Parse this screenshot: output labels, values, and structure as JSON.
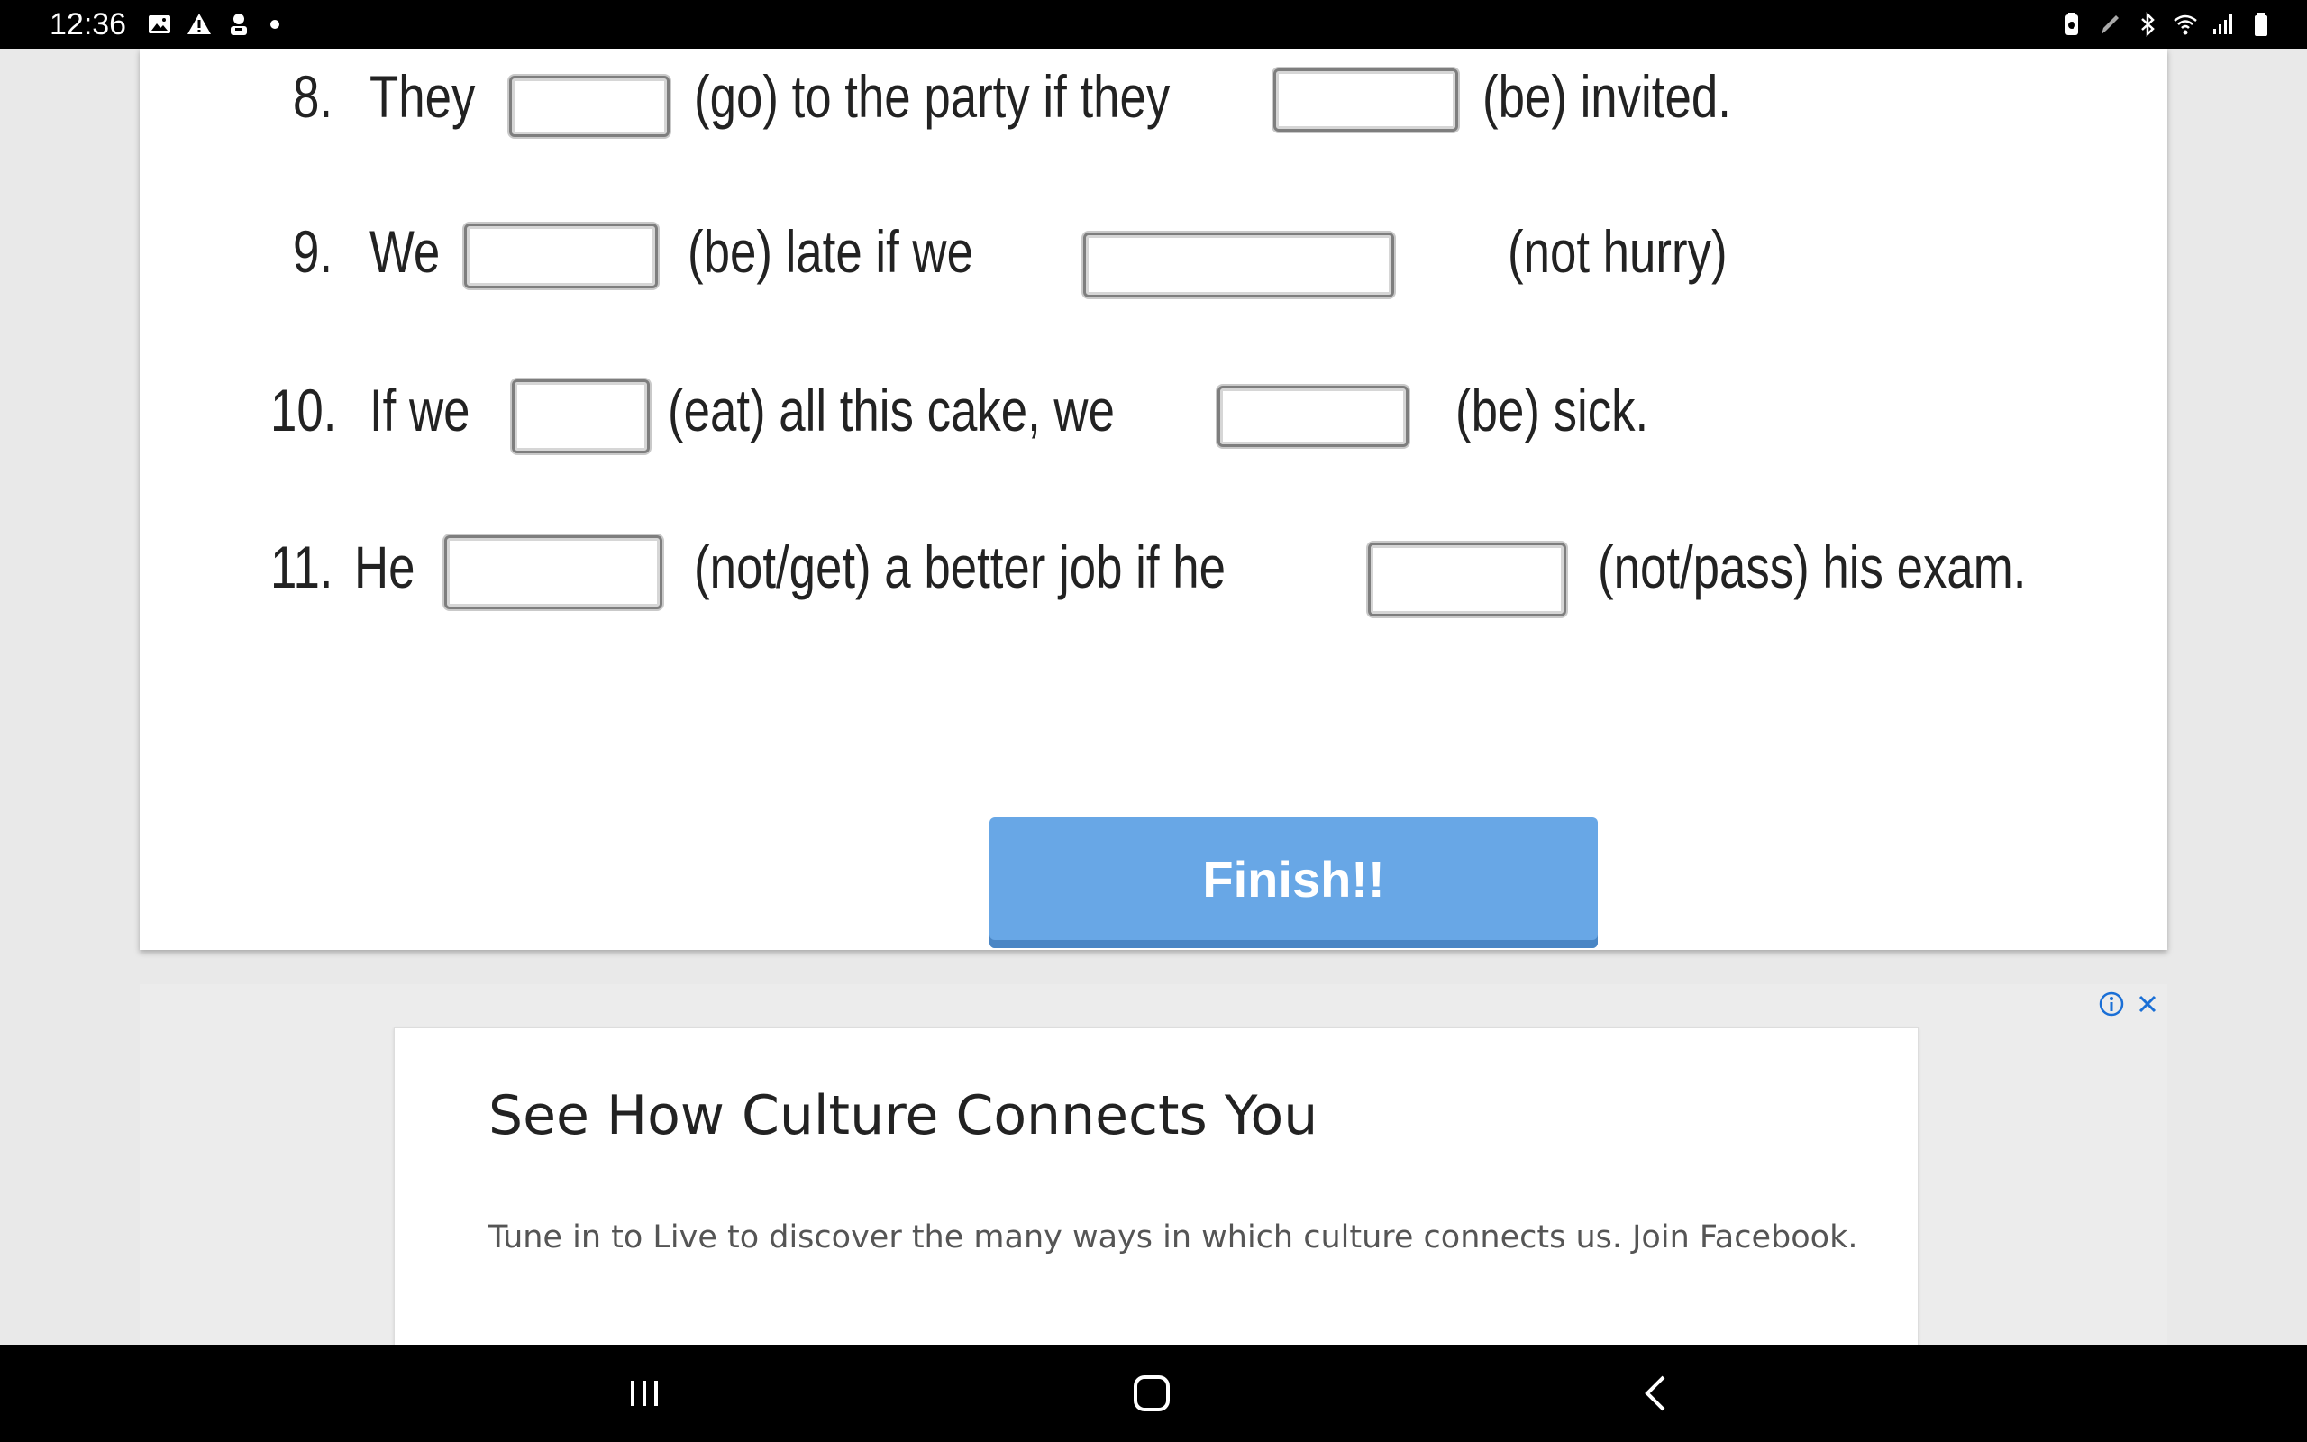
{
  "status_bar": {
    "time": "12:36",
    "left_icons": [
      "gallery-icon",
      "warning-icon",
      "profile-icon",
      "notification-dot"
    ],
    "right_icons": [
      "battery-saver-icon",
      "pen-icon",
      "bluetooth-icon",
      "wifi-icon",
      "signal-icon",
      "battery-icon"
    ]
  },
  "worksheet": {
    "questions": [
      {
        "number": "8.",
        "segments": [
          "They",
          "(go) to the party if they",
          "(be) invited."
        ]
      },
      {
        "number": "9.",
        "segments": [
          "We",
          "(be) late if we",
          "(not hurry)"
        ]
      },
      {
        "number": "10.",
        "segments": [
          "If we",
          "(eat) all this cake, we",
          "(be) sick."
        ]
      },
      {
        "number": "11.",
        "segments": [
          "He",
          "(not/get) a better job if he",
          "(not/pass) his exam."
        ]
      }
    ],
    "finish_label": "Finish!!"
  },
  "ad": {
    "title": "See How Culture Connects You",
    "description": "Tune in to Live to discover the many ways in which culture connects us. Join Facebook.",
    "icons": [
      "ad-info-icon",
      "ad-close-icon"
    ]
  },
  "nav_bar": {
    "icons": [
      "recent-apps-icon",
      "home-icon",
      "back-icon"
    ]
  }
}
